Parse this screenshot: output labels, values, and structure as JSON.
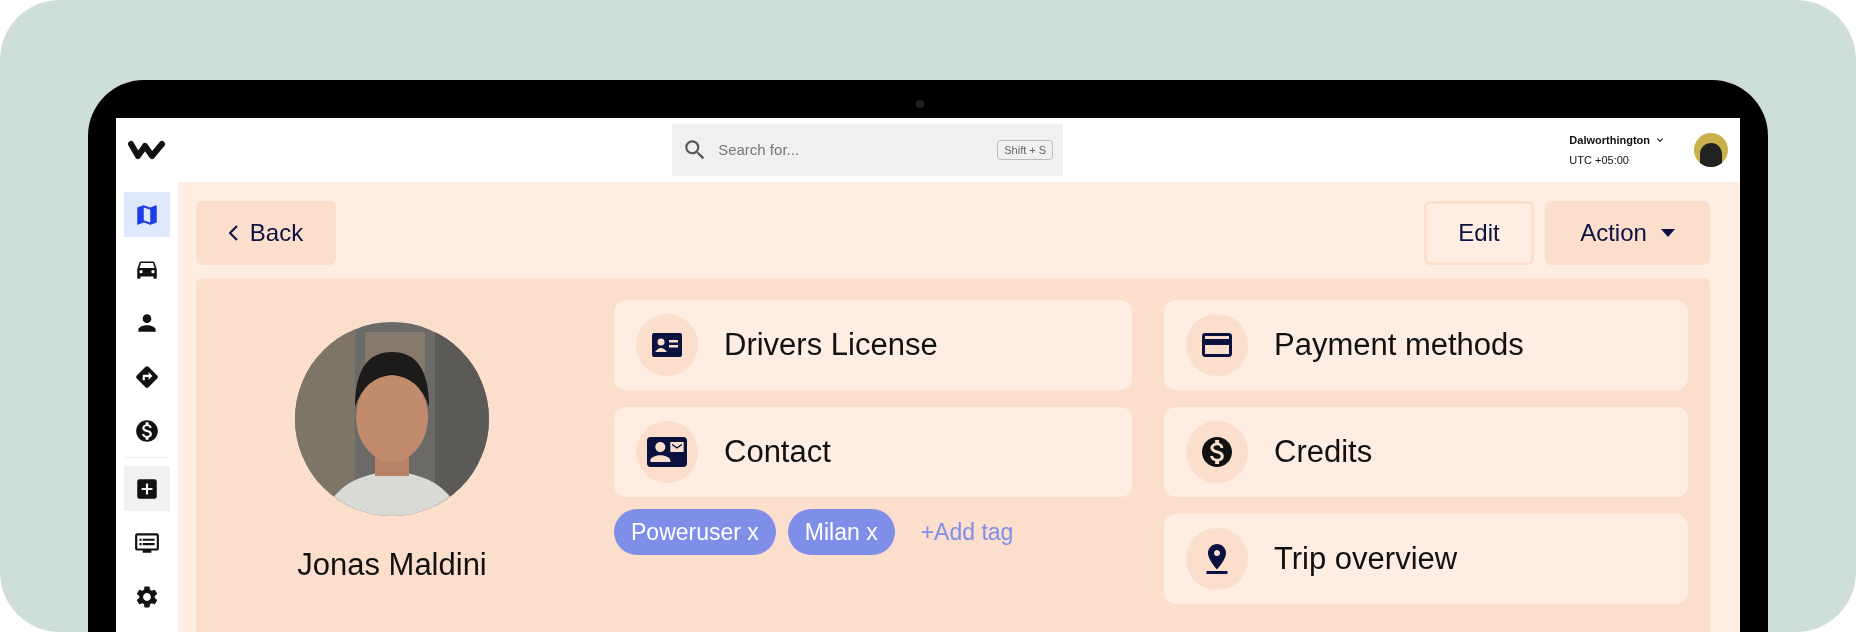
{
  "topbar": {
    "search": {
      "placeholder": "Search for...",
      "shortcut": "Shift + S"
    },
    "account": {
      "name": "Dalworthington",
      "timezone": "UTC +05:00"
    }
  },
  "sidebar": {
    "groups": [
      [
        {
          "kind": "nav",
          "selected": true
        },
        {
          "kind": "nav",
          "selected": false
        },
        {
          "kind": "nav",
          "selected": false
        },
        {
          "kind": "nav",
          "selected": false
        },
        {
          "kind": "nav",
          "selected": false
        }
      ],
      [
        {
          "kind": "action",
          "selected": false
        },
        {
          "kind": "nav",
          "selected": false
        },
        {
          "kind": "nav",
          "selected": false
        }
      ]
    ]
  },
  "toolbar": {
    "back": "Back",
    "edit": "Edit",
    "action": "Action"
  },
  "profile": {
    "name": "Jonas Maldini"
  },
  "left_cards": [
    {
      "label": "Drivers License"
    },
    {
      "label": "Contact"
    }
  ],
  "tags": [
    {
      "label": "Poweruser x"
    },
    {
      "label": "Milan x"
    }
  ],
  "add_tag": "+Add tag",
  "right_cards": [
    {
      "label": "Payment methods"
    },
    {
      "label": "Credits"
    },
    {
      "label": "Trip overview"
    }
  ]
}
